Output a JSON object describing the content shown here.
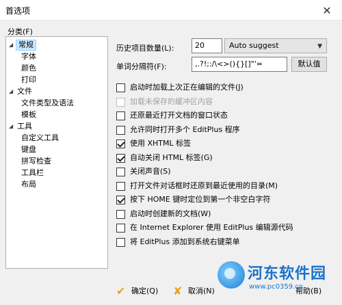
{
  "window": {
    "title": "首选项",
    "close_glyph": "✕"
  },
  "category_label": "分类(F)",
  "tree": [
    {
      "label": "常规",
      "level": 0,
      "expanded": true,
      "selected": true
    },
    {
      "label": "字体",
      "level": 1
    },
    {
      "label": "颜色",
      "level": 1
    },
    {
      "label": "打印",
      "level": 1
    },
    {
      "label": "文件",
      "level": 0,
      "expanded": true
    },
    {
      "label": "文件类型及语法",
      "level": 1
    },
    {
      "label": "模板",
      "level": 1
    },
    {
      "label": "工具",
      "level": 0,
      "expanded": true
    },
    {
      "label": "自定义工具",
      "level": 1
    },
    {
      "label": "键盘",
      "level": 1
    },
    {
      "label": "拼写检查",
      "level": 1
    },
    {
      "label": "工具栏",
      "level": 1
    },
    {
      "label": "布局",
      "level": 1
    }
  ],
  "history": {
    "label": "历史项目数量(L):",
    "value": "20",
    "dropdown_value": "Auto suggest"
  },
  "word_sep": {
    "label": "单词分隔符(F):",
    "value": ",.?!;:/\\<>(){}[]\"'=",
    "default_button": "默认值"
  },
  "options": [
    {
      "label": "启动时加载上次正在编辑的文件(J)",
      "checked": false,
      "disabled": false
    },
    {
      "label": "加载未保存的缓冲区内容",
      "checked": false,
      "disabled": true
    },
    {
      "label": "还原最近打开文档的窗口状态",
      "checked": false,
      "disabled": false
    },
    {
      "label": "允许同时打开多个 EditPlus 程序",
      "checked": false,
      "disabled": false
    },
    {
      "label": "使用 XHTML 标签",
      "checked": true,
      "disabled": false
    },
    {
      "label": "自动关闭 HTML 标签(G)",
      "checked": true,
      "disabled": false
    },
    {
      "label": "关闭声音(S)",
      "checked": false,
      "disabled": false
    },
    {
      "label": "打开文件对话框时还原到最近使用的目录(M)",
      "checked": false,
      "disabled": false
    },
    {
      "label": "按下 HOME 键时定位到第一个非空白字符",
      "checked": true,
      "disabled": false
    },
    {
      "label": "启动时创建新的文档(W)",
      "checked": false,
      "disabled": false
    },
    {
      "label": "在 Internet Explorer 使用 EditPlus 编辑源代码",
      "checked": false,
      "disabled": false
    },
    {
      "label": "将 EditPlus 添加到系统右键菜单",
      "checked": false,
      "disabled": false
    }
  ],
  "footer": {
    "ok": {
      "label": "确定(Q)",
      "icon": "check-icon",
      "color": "#e8a317"
    },
    "cancel": {
      "label": "取消(N)",
      "icon": "cross-icon",
      "color": "#e8a317"
    },
    "help": {
      "label": "帮助(B)",
      "icon": "help-icon"
    }
  },
  "watermark": {
    "name": "河东软件园",
    "url": "www.pc0359.cn",
    "color": "#1a73c9"
  }
}
